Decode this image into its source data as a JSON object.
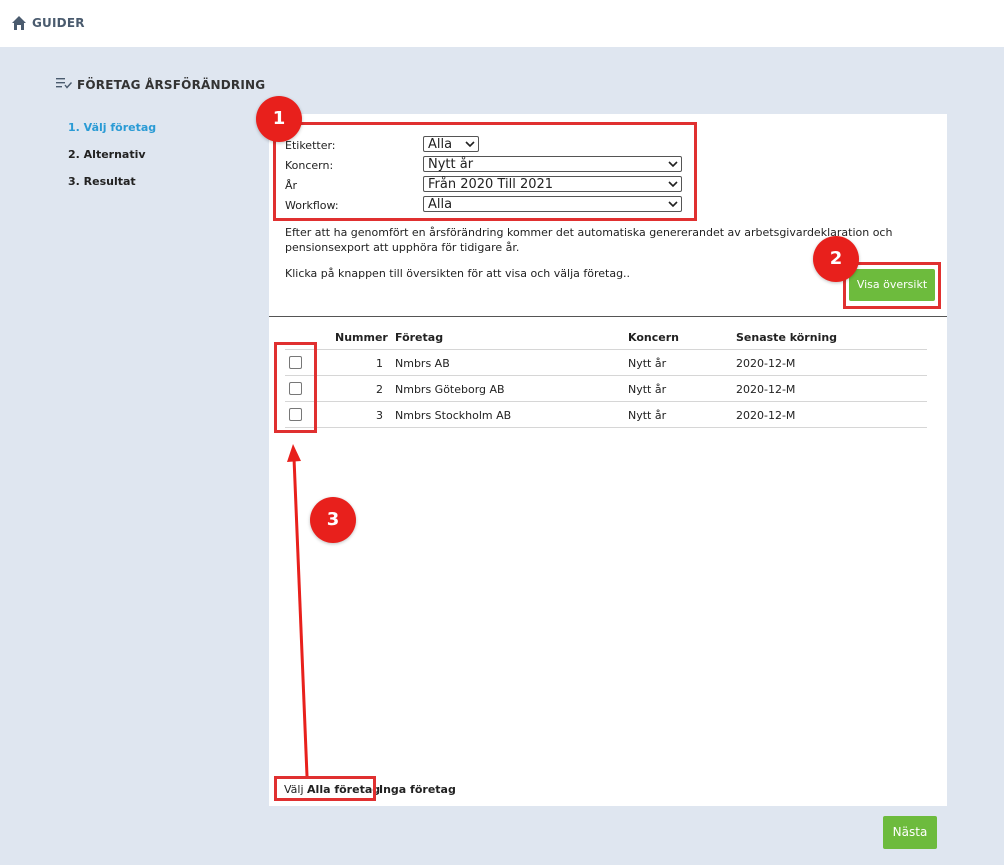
{
  "topbar": {
    "title": "GUIDER",
    "icon": "home-icon"
  },
  "page": {
    "title": "FÖRETAG ÅRSFÖRÄNDRING",
    "icon": "list-check-icon"
  },
  "steps": [
    {
      "label": "1. Välj företag",
      "active": true
    },
    {
      "label": "2. Alternativ",
      "active": false
    },
    {
      "label": "3. Resultat",
      "active": false
    }
  ],
  "filters": {
    "etiketter": {
      "label": "Etiketter:",
      "value": "Alla"
    },
    "koncern": {
      "label": "Koncern:",
      "value": "Nytt år"
    },
    "ar": {
      "label": "År",
      "value": "Från 2020 Till 2021"
    },
    "workflow": {
      "label": "Workflow:",
      "value": "Alla"
    }
  },
  "info": {
    "warning": "Efter att ha genomfört en årsförändring kommer det automatiska genererandet av arbetsgivardeklaration och pensionsexport att upphöra för tidigare år.",
    "instruction": "Klicka på knappen till översikten för att visa och välja företag.."
  },
  "buttons": {
    "overview": "Visa översikt",
    "next": "Nästa"
  },
  "table": {
    "headers": {
      "nummer": "Nummer",
      "foretag": "Företag",
      "koncern": "Koncern",
      "senaste": "Senaste körning"
    },
    "rows": [
      {
        "nummer": "1",
        "foretag": "Nmbrs AB",
        "koncern": "Nytt år",
        "senaste": "2020-12-M"
      },
      {
        "nummer": "2",
        "foretag": "Nmbrs Göteborg AB",
        "koncern": "Nytt år",
        "senaste": "2020-12-M"
      },
      {
        "nummer": "3",
        "foretag": "Nmbrs Stockholm AB",
        "koncern": "Nytt år",
        "senaste": "2020-12-M"
      }
    ]
  },
  "select_links": {
    "prefix": "Välj",
    "all": "Alla företag",
    "none": "Inga företag"
  },
  "annotations": {
    "one": "1",
    "two": "2",
    "three": "3"
  },
  "colors": {
    "accent": "#2a9bd5",
    "green": "#6dbb3d",
    "annotation": "#e03030"
  }
}
